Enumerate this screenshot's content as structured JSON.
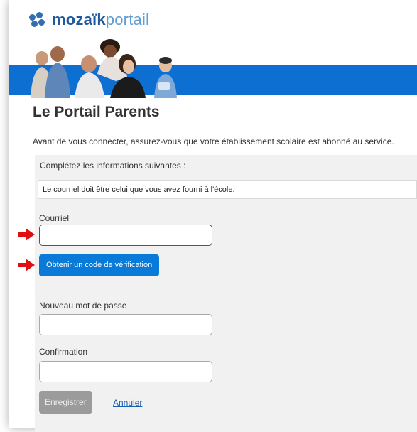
{
  "header": {
    "logo_bold": "mozaïk",
    "logo_light": "portail",
    "banner_image": "family-photo"
  },
  "page": {
    "title": "Le Portail Parents",
    "intro": "Avant de vous connecter, assurez-vous que votre établissement scolaire est abonné au service."
  },
  "form": {
    "instruction": "Complétez les informations suivantes :",
    "notice": "Le courriel doit être celui que vous avez fourni à l'école.",
    "email_label": "Courriel",
    "email_value": "",
    "verify_button": "Obtenir un code de vérification",
    "new_password_label": "Nouveau mot de passe",
    "new_password_value": "",
    "confirm_label": "Confirmation",
    "confirm_value": "",
    "save_button": "Enregistrer",
    "cancel_link": "Annuler"
  },
  "annotations": {
    "arrow_color": "#e01010",
    "arrow_icon": "red-arrow-right-icon"
  },
  "colors": {
    "brand_blue": "#0d6fd2",
    "button_blue": "#0a7ad8",
    "disabled_gray": "#9b9b9b",
    "panel_gray": "#f1f1f1"
  }
}
